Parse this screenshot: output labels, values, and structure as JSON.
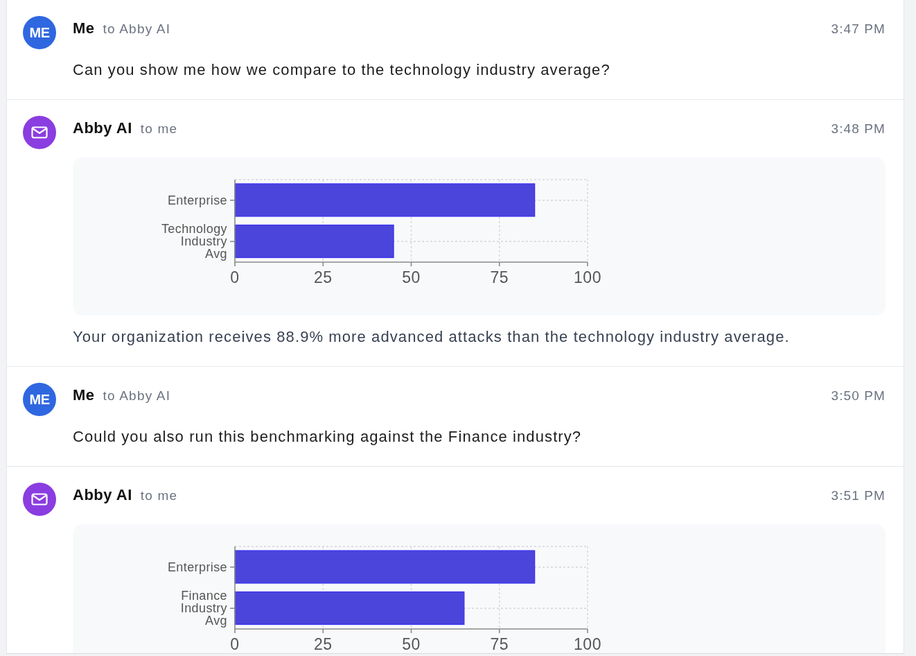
{
  "messages": [
    {
      "kind": "user",
      "avatar": "ME",
      "sender": "Me",
      "recipient": "to Abby AI",
      "time": "3:47 PM",
      "text": "Can you show me how we compare to the technology industry average?"
    },
    {
      "kind": "ai",
      "sender": "Abby AI",
      "recipient": "to me",
      "time": "3:48 PM",
      "chart_data": {
        "type": "bar",
        "orientation": "horizontal",
        "categories": [
          "Enterprise",
          "Technology Industry Avg"
        ],
        "values": [
          85,
          45
        ],
        "xlim": [
          0,
          100
        ],
        "xticks": [
          0,
          25,
          50,
          75,
          100
        ],
        "grid": true
      },
      "text": "Your organization receives 88.9% more advanced attacks than the technology industry average."
    },
    {
      "kind": "user",
      "avatar": "ME",
      "sender": "Me",
      "recipient": "to Abby AI",
      "time": "3:50 PM",
      "text": "Could you also run this benchmarking against the Finance industry?"
    },
    {
      "kind": "ai",
      "sender": "Abby AI",
      "recipient": "to me",
      "time": "3:51 PM",
      "chart_data": {
        "type": "bar",
        "orientation": "horizontal",
        "categories": [
          "Enterprise",
          "Finance Industry Avg"
        ],
        "values": [
          85,
          65
        ],
        "xlim": [
          0,
          100
        ],
        "xticks": [
          0,
          25,
          50,
          75,
          100
        ],
        "grid": true
      }
    }
  ]
}
